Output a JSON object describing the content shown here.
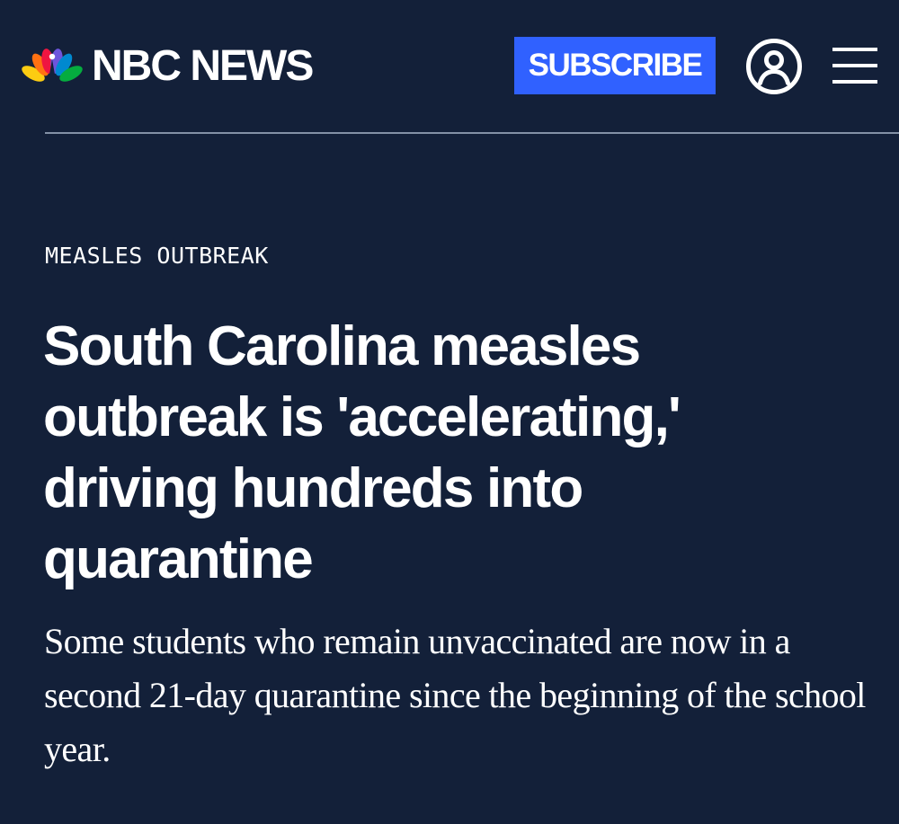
{
  "header": {
    "brand_name": "NBC NEWS",
    "logo_icon": "nbc-peacock-icon",
    "subscribe_label": "SUBSCRIBE",
    "account_icon": "user-account-icon",
    "menu_icon": "hamburger-menu-icon"
  },
  "article": {
    "kicker": "MEASLES OUTBREAK",
    "headline": "South Carolina measles outbreak is 'accelerating,' driving hundreds into quarantine",
    "dek": "Some students who remain unvaccinated are now in a second 21-day quarantine since the beginning of the school year."
  },
  "colors": {
    "background": "#132039",
    "subscribe_button": "#3061ff",
    "divider": "#8391a6",
    "text": "#ffffff",
    "peacock_feathers": [
      "#fccc12",
      "#ef1541",
      "#6e55dc",
      "#0089d0",
      "#05ac3f",
      "#ff7112"
    ]
  }
}
